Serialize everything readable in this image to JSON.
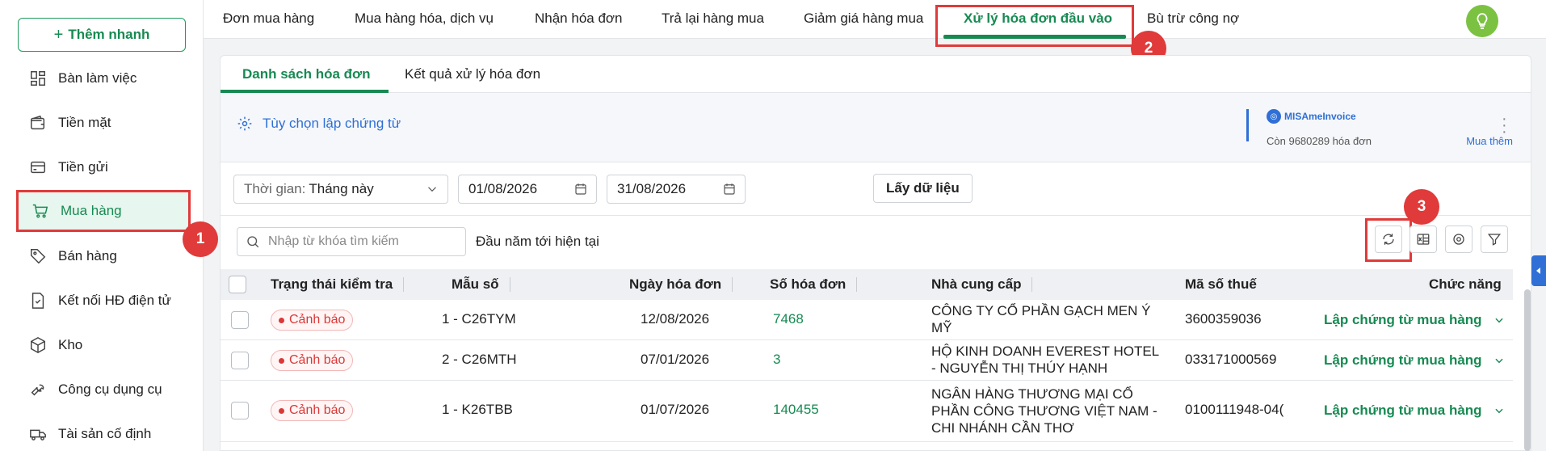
{
  "sidebar": {
    "quick_add_label": "Thêm nhanh",
    "items": [
      {
        "label": "Bàn làm việc",
        "icon": "dashboard-icon"
      },
      {
        "label": "Tiền mặt",
        "icon": "wallet-icon"
      },
      {
        "label": "Tiền gửi",
        "icon": "bank-card-icon"
      },
      {
        "label": "Mua hàng",
        "icon": "cart-icon",
        "active": true
      },
      {
        "label": "Bán hàng",
        "icon": "tag-icon"
      },
      {
        "label": "Kết nối HĐ điện tử",
        "icon": "e-invoice-icon"
      },
      {
        "label": "Kho",
        "icon": "box-icon"
      },
      {
        "label": "Công cụ dụng cụ",
        "icon": "wrench-icon"
      },
      {
        "label": "Tài sản cố định",
        "icon": "truck-icon"
      }
    ]
  },
  "callouts": [
    "1",
    "2",
    "3"
  ],
  "top_tabs": [
    "Đơn mua hàng",
    "Mua hàng hóa, dịch vụ",
    "Nhận hóa đơn",
    "Trả lại hàng mua",
    "Giảm giá hàng mua",
    "Xử lý hóa đơn đầu vào",
    "Bù trừ công nợ"
  ],
  "sub_tabs": [
    "Danh sách hóa đơn",
    "Kết quả xử lý hóa đơn"
  ],
  "voucher_option": "Tùy chọn lập chứng từ",
  "misa": {
    "logo_text": "MISAmeInvoice",
    "remaining": "Còn 9680289 hóa đơn",
    "buy_more": "Mua thêm"
  },
  "filters": {
    "time_label": "Thời gian:",
    "time_value": "Tháng này",
    "from_date": "01/08/2026",
    "to_date": "31/08/2026",
    "get_data": "Lấy dữ liệu"
  },
  "search": {
    "placeholder": "Nhập từ khóa tìm kiếm",
    "period_text": "Đầu năm tới hiện tại"
  },
  "table": {
    "headers": [
      "Trạng thái kiểm tra",
      "Mẫu số",
      "Ngày hóa đơn",
      "Số hóa đơn",
      "Nhà cung cấp",
      "Mã số thuế",
      "Chức năng"
    ],
    "rows": [
      {
        "status": "Cảnh báo",
        "form": "1 - C26TYM",
        "date": "12/08/2026",
        "number": "7468",
        "supplier": "CÔNG TY CỔ PHẦN GẠCH MEN Ý MỸ",
        "tax": "3600359036",
        "action": "Lập chứng từ mua hàng"
      },
      {
        "status": "Cảnh báo",
        "form": "2 - C26MTH",
        "date": "07/01/2026",
        "number": "3",
        "supplier": "HỘ KINH DOANH EVEREST HOTEL - NGUYỄN THỊ THÚY HẠNH",
        "tax": "033171000569",
        "action": "Lập chứng từ mua hàng"
      },
      {
        "status": "Cảnh báo",
        "form": "1 - K26TBB",
        "date": "01/07/2026",
        "number": "140455",
        "supplier": "NGÂN HÀNG THƯƠNG MẠI CỔ PHẦN CÔNG THƯƠNG VIỆT NAM - CHI NHÁNH CẦN THƠ",
        "tax": "0100111948-04(",
        "action": "Lập chứng từ mua hàng"
      }
    ]
  },
  "colors": {
    "accent": "#178a52",
    "warning": "#d93939",
    "link": "#2f6fd6",
    "highlight": "#e03a3a"
  }
}
